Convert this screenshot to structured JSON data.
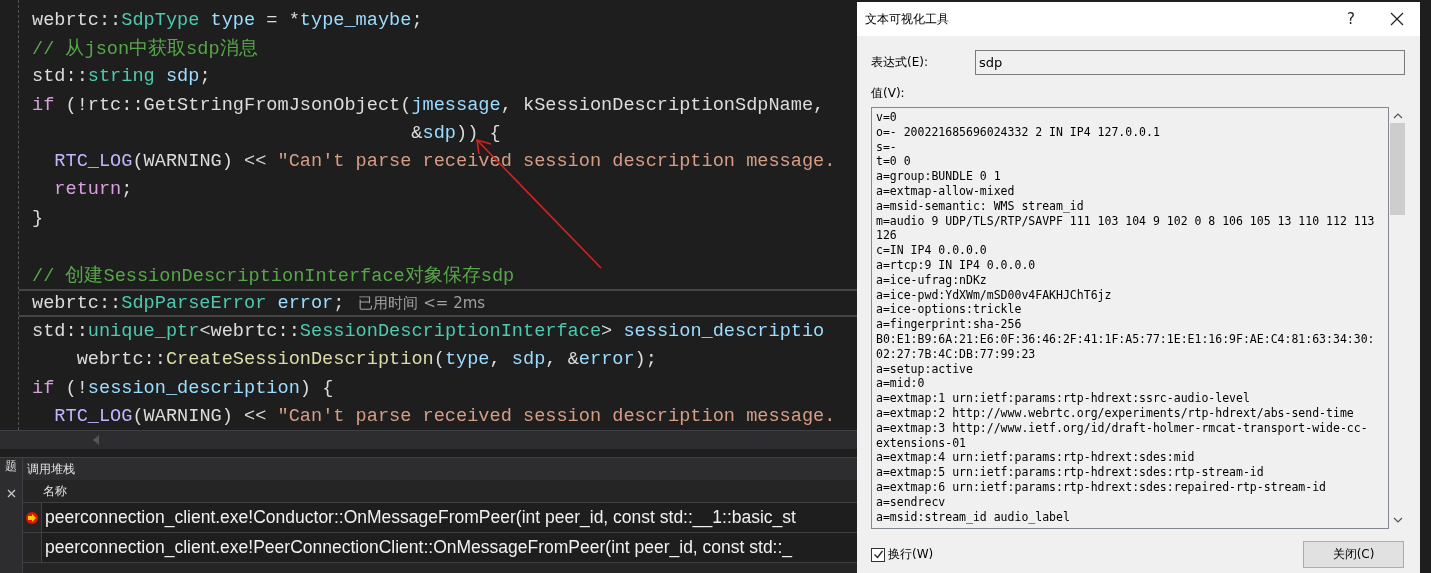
{
  "editor": {
    "lines": [
      {
        "tokens": [
          {
            "kind": "plain",
            "text": "webrtc::"
          },
          {
            "kind": "type",
            "text": "SdpType"
          },
          {
            "kind": "var",
            "text": " type"
          },
          {
            "kind": "plain",
            "text": " = *"
          },
          {
            "kind": "var",
            "text": "type_maybe"
          },
          {
            "kind": "plain",
            "text": ";"
          }
        ]
      },
      {
        "tokens": [
          {
            "kind": "comment",
            "text": "// 从json中获取sdp消息"
          }
        ]
      },
      {
        "tokens": [
          {
            "kind": "plain",
            "text": "std::"
          },
          {
            "kind": "type",
            "text": "string"
          },
          {
            "kind": "var",
            "text": " sdp"
          },
          {
            "kind": "plain",
            "text": ";"
          }
        ]
      },
      {
        "tokens": [
          {
            "kind": "keyword",
            "text": "if"
          },
          {
            "kind": "plain",
            "text": " (!rtc::GetStringFromJsonObject("
          },
          {
            "kind": "var",
            "text": "jmessage"
          },
          {
            "kind": "plain",
            "text": ", kSessionDescriptionSdpName,"
          }
        ]
      },
      {
        "tokens": [
          {
            "kind": "plain",
            "text": "                                  &"
          },
          {
            "kind": "var",
            "text": "sdp"
          },
          {
            "kind": "plain",
            "text": ")) {"
          }
        ]
      },
      {
        "tokens": [
          {
            "kind": "macro",
            "text": "  RTC_LOG"
          },
          {
            "kind": "plain",
            "text": "(WARNING) << "
          },
          {
            "kind": "string",
            "text": "\"Can't parse received session description message."
          }
        ]
      },
      {
        "tokens": [
          {
            "kind": "keyword",
            "text": "  return"
          },
          {
            "kind": "plain",
            "text": ";"
          }
        ]
      },
      {
        "tokens": [
          {
            "kind": "plain",
            "text": "}"
          }
        ]
      },
      {
        "tokens": [
          {
            "kind": "comment",
            "text": "// 创建SessionDescriptionInterface对象保存sdp"
          }
        ],
        "gap_before": true
      },
      {
        "tokens": [
          {
            "kind": "plain",
            "text": "webrtc::"
          },
          {
            "kind": "type",
            "text": "SdpParseError"
          },
          {
            "kind": "var",
            "text": " error"
          },
          {
            "kind": "plain",
            "text": ";"
          }
        ],
        "current": true,
        "perf_tip": "已用时间 <= 2ms"
      },
      {
        "tokens": [
          {
            "kind": "plain",
            "text": "std::"
          },
          {
            "kind": "type",
            "text": "unique_ptr"
          },
          {
            "kind": "plain",
            "text": "<webrtc::"
          },
          {
            "kind": "type",
            "text": "SessionDescriptionInterface"
          },
          {
            "kind": "plain",
            "text": "> "
          },
          {
            "kind": "var",
            "text": "session_descriptio"
          }
        ]
      },
      {
        "tokens": [
          {
            "kind": "plain",
            "text": "    webrtc::"
          },
          {
            "kind": "func",
            "text": "CreateSessionDescription"
          },
          {
            "kind": "plain",
            "text": "("
          },
          {
            "kind": "var",
            "text": "type"
          },
          {
            "kind": "plain",
            "text": ", "
          },
          {
            "kind": "var",
            "text": "sdp"
          },
          {
            "kind": "plain",
            "text": ", &"
          },
          {
            "kind": "var",
            "text": "error"
          },
          {
            "kind": "plain",
            "text": ");"
          }
        ]
      },
      {
        "tokens": [
          {
            "kind": "keyword",
            "text": "if"
          },
          {
            "kind": "plain",
            "text": " (!"
          },
          {
            "kind": "var",
            "text": "session_description"
          },
          {
            "kind": "plain",
            "text": ") {"
          }
        ]
      },
      {
        "tokens": [
          {
            "kind": "macro",
            "text": "  RTC_LOG"
          },
          {
            "kind": "plain",
            "text": "(WARNING) << "
          },
          {
            "kind": "string",
            "text": "\"Can't parse received session description message."
          }
        ]
      }
    ]
  },
  "side_tab": "题",
  "call_stack": {
    "title": "调用堆栈",
    "column": "名称",
    "rows": [
      {
        "text": "peerconnection_client.exe!Conductor::OnMessageFromPeer(int peer_id, const std::__1::basic_st",
        "current": true
      },
      {
        "text": "peerconnection_client.exe!PeerConnectionClient::OnMessageFromPeer(int peer_id, const std::_",
        "current": false
      }
    ]
  },
  "dialog": {
    "title": "文本可视化工具",
    "help": "?",
    "expression_label": "表达式(E):",
    "expression": "sdp",
    "value_label": "值(V):",
    "value_lines": [
      "v=0",
      "o=- 200221685696024332 2 IN IP4 127.0.0.1",
      "s=-",
      "t=0 0",
      "a=group:BUNDLE 0 1",
      "a=extmap-allow-mixed",
      "a=msid-semantic: WMS stream_id",
      "m=audio 9 UDP/TLS/RTP/SAVPF 111 103 104 9 102 0 8 106 105 13 110 112 113",
      "126",
      "c=IN IP4 0.0.0.0",
      "a=rtcp:9 IN IP4 0.0.0.0",
      "a=ice-ufrag:nDKz",
      "a=ice-pwd:YdXWm/mSD00v4FAKHJChT6jz",
      "a=ice-options:trickle",
      "a=fingerprint:sha-256",
      "B0:E1:B9:6A:21:E6:0F:36:46:2F:41:1F:A5:77:1E:E1:16:9F:AE:C4:81:63:34:30:",
      "02:27:7B:4C:DB:77:99:23",
      "a=setup:active",
      "a=mid:0",
      "a=extmap:1 urn:ietf:params:rtp-hdrext:ssrc-audio-level",
      "a=extmap:2 http://www.webrtc.org/experiments/rtp-hdrext/abs-send-time",
      "a=extmap:3 http://www.ietf.org/id/draft-holmer-rmcat-transport-wide-cc-",
      "extensions-01",
      "a=extmap:4 urn:ietf:params:rtp-hdrext:sdes:mid",
      "a=extmap:5 urn:ietf:params:rtp-hdrext:sdes:rtp-stream-id",
      "a=extmap:6 urn:ietf:params:rtp-hdrext:sdes:repaired-rtp-stream-id",
      "a=sendrecv",
      "a=msid:stream_id audio_label"
    ],
    "wrap": {
      "label": "换行(W)",
      "checked": true
    },
    "close_button": "关闭(C)"
  }
}
